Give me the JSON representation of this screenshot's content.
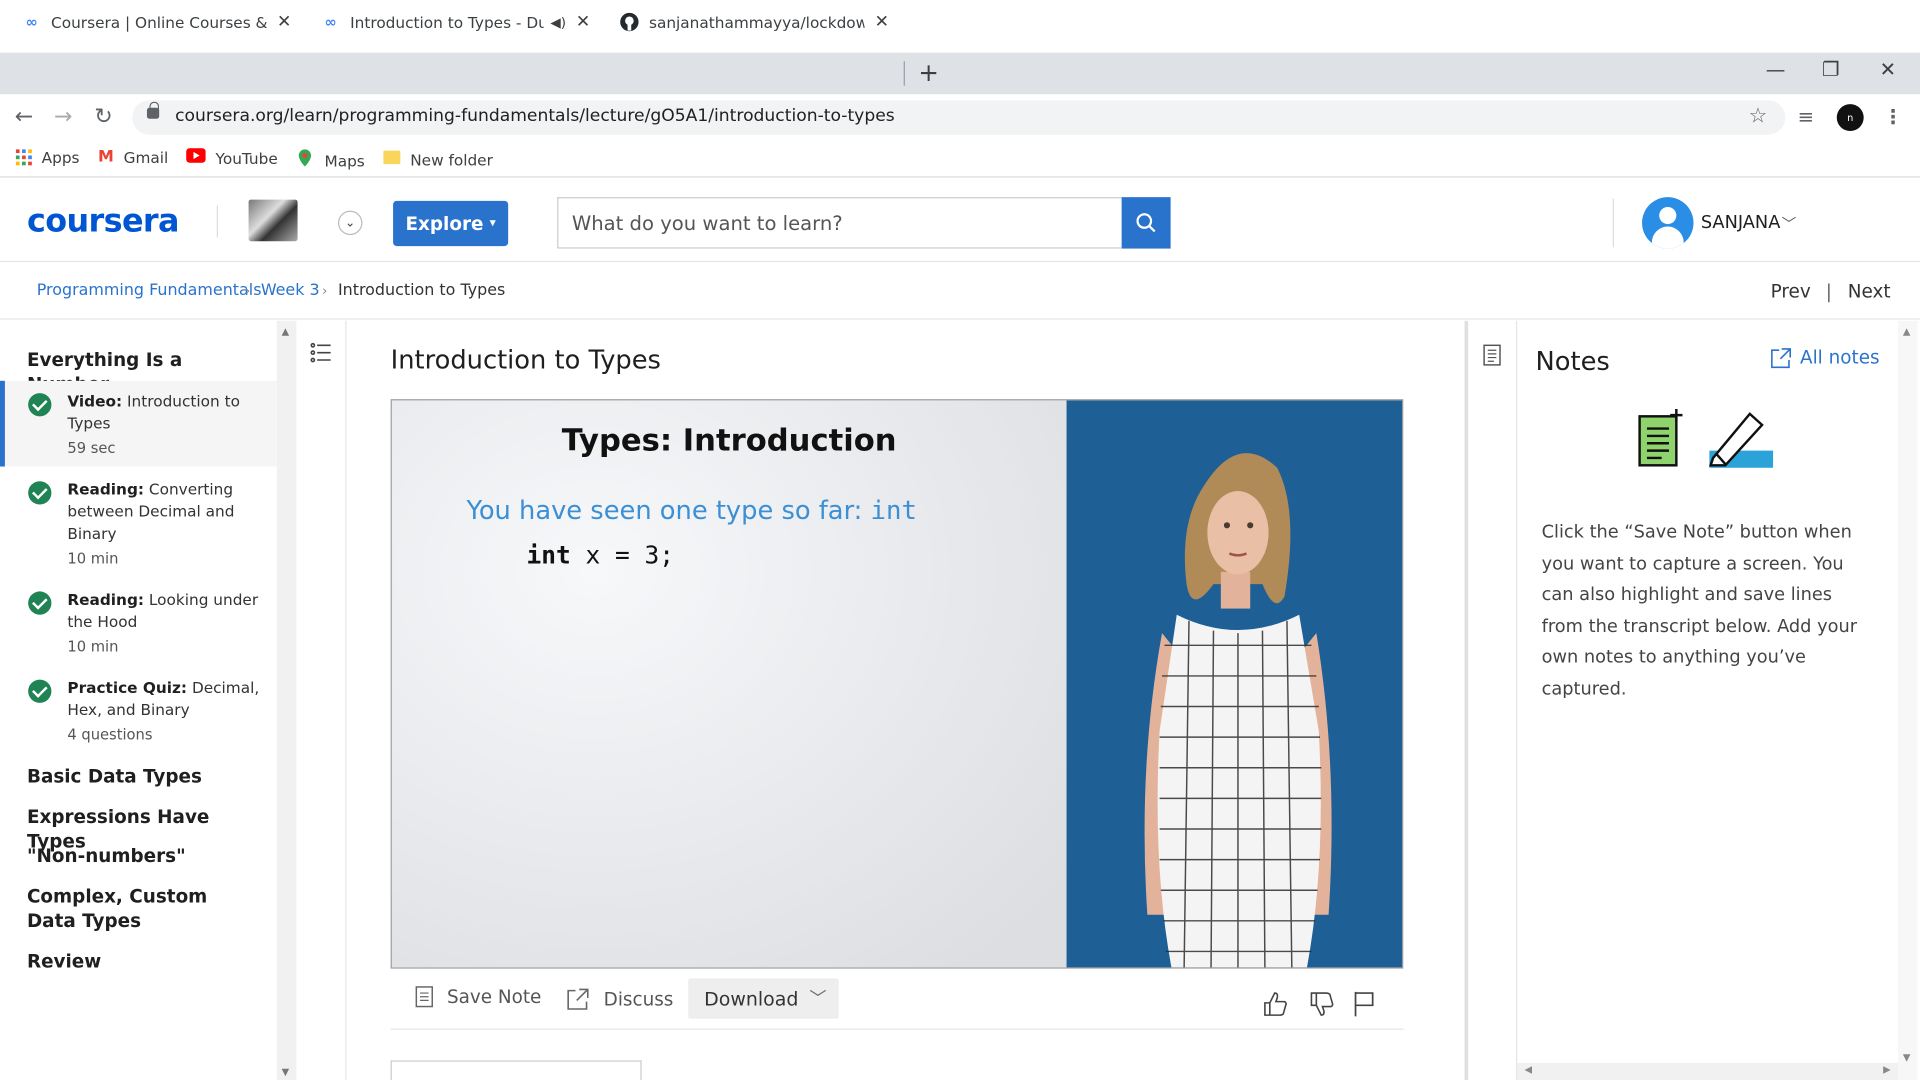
{
  "browser": {
    "tabs": [
      {
        "title": "Coursera | Online Courses & Credentials",
        "active": false
      },
      {
        "title": "Introduction to Types - Duke University",
        "active": true
      },
      {
        "title": "sanjanathammayya/lockdown-ce",
        "active": false
      }
    ],
    "url": "coursera.org/learn/programming-fundamentals/lecture/gO5A1/introduction-to-types",
    "profile_initial": "n",
    "bookmarks": [
      {
        "label": "Apps",
        "icon": "apps-grid-icon"
      },
      {
        "label": "Gmail",
        "icon": "gmail-icon"
      },
      {
        "label": "YouTube",
        "icon": "youtube-icon"
      },
      {
        "label": "Maps",
        "icon": "maps-icon"
      },
      {
        "label": "New folder",
        "icon": "folder-icon"
      }
    ]
  },
  "header": {
    "logo": "coursera",
    "explore_label": "Explore",
    "search_placeholder": "What do you want to learn?",
    "username": "SANJANA"
  },
  "breadcrumb": {
    "items": [
      "Programming Fundamentals",
      "Week 3",
      "Introduction to Types"
    ],
    "prev": "Prev",
    "next": "Next"
  },
  "sidebar": {
    "module_title": "Everything Is a Number",
    "items": [
      {
        "type": "Video:",
        "title": "Introduction to Types",
        "meta": "59 sec",
        "active": true,
        "completed": true
      },
      {
        "type": "Reading:",
        "title": "Converting between Decimal and Binary",
        "meta": "10 min",
        "active": false,
        "completed": true
      },
      {
        "type": "Reading:",
        "title": "Looking under the Hood",
        "meta": "10 min",
        "active": false,
        "completed": true
      },
      {
        "type": "Practice Quiz:",
        "title": "Decimal, Hex, and Binary",
        "meta": "4 questions",
        "active": false,
        "completed": true
      }
    ],
    "sections": [
      "Basic Data Types",
      "Expressions Have Types",
      "\"Non-numbers\"",
      "Complex, Custom Data Types",
      "Review"
    ]
  },
  "main": {
    "title": "Introduction to Types",
    "slide": {
      "title": "Types: Introduction",
      "line1_text": "You have seen one type so far: ",
      "line1_code": "int",
      "code_kw": "int",
      "code_rest": " x = 3;"
    },
    "toolbar": {
      "save_note": "Save Note",
      "discuss": "Discuss",
      "download": "Download"
    }
  },
  "notes": {
    "title": "Notes",
    "all_notes": "All notes",
    "description": "Click the “Save Note” button when you want to capture a screen. You can also highlight and save lines from the transcript below. Add your own notes to anything you’ve captured."
  },
  "colors": {
    "brand": "#0056d2",
    "accent": "#2a73cc",
    "complete": "#1f8354"
  }
}
